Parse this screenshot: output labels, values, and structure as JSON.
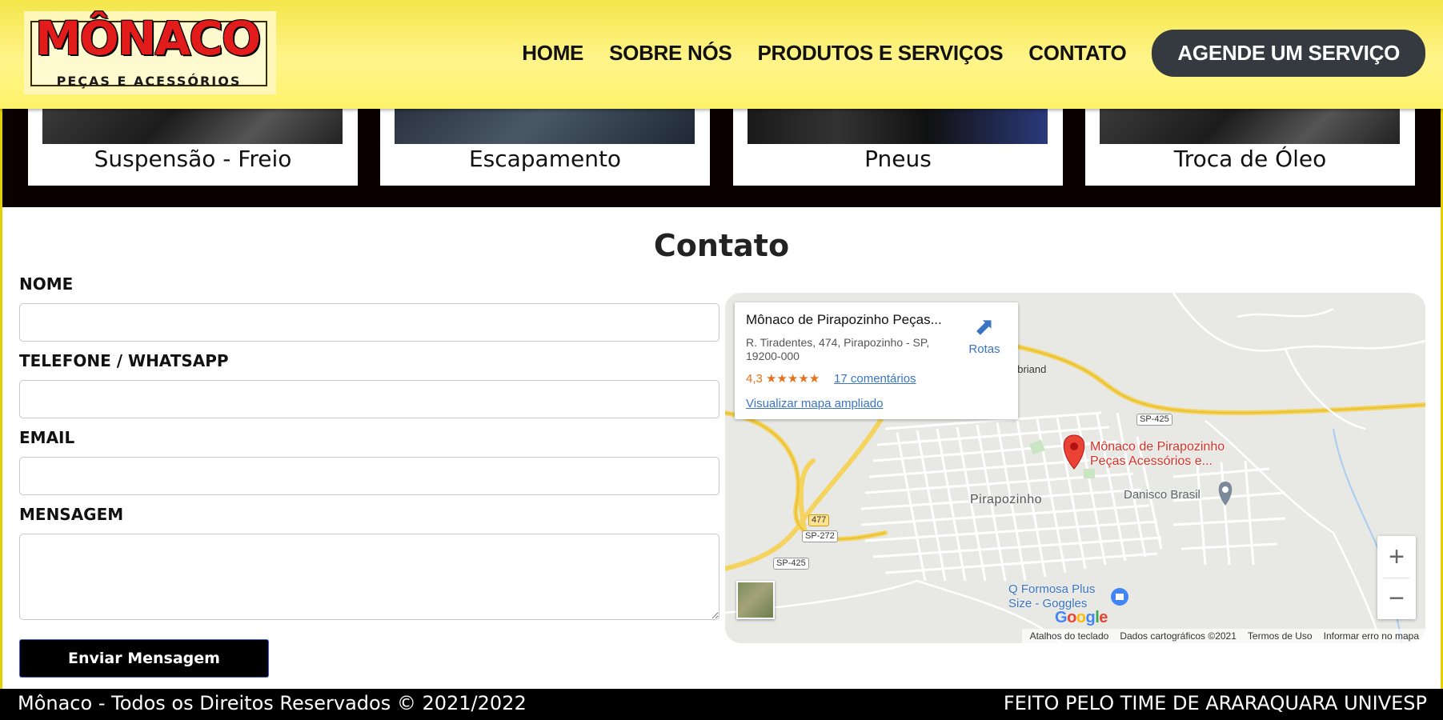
{
  "brand": {
    "logo_word": "MÔNACO",
    "logo_sub": "PEÇAS E ACESSÓRIOS",
    "colors": {
      "header_yellow": "#fff48a",
      "logo_red": "#e21b1b",
      "cta_bg": "#343a40"
    }
  },
  "nav": {
    "home": "HOME",
    "about": "SOBRE NÓS",
    "products": "PRODUTOS E SERVIÇOS",
    "contact": "CONTATO",
    "cta": "AGENDE UM SERVIÇO"
  },
  "services": [
    {
      "label": "Suspensão - Freio"
    },
    {
      "label": "Escapamento"
    },
    {
      "label": "Pneus"
    },
    {
      "label": "Troca de Óleo"
    }
  ],
  "contact": {
    "title": "Contato",
    "fields": {
      "name_label": "NOME",
      "phone_label": "TELEFONE / WHATSAPP",
      "email_label": "EMAIL",
      "message_label": "MENSAGEM"
    },
    "submit": "Enviar Mensagem"
  },
  "map": {
    "place_name": "Mônaco de Pirapozinho Peças...",
    "address": "R. Tiradentes, 474, Pirapozinho - SP, 19200-000",
    "rating": "4,3",
    "stars": "★★★★★",
    "reviews": "17 comentários",
    "view_larger": "Visualizar mapa ampliado",
    "directions": "Rotas",
    "pin_label_1": "Mônaco de Pirapozinho",
    "pin_label_2": "Peças Acessórios e...",
    "town": "Pirapozinho",
    "poi_danisco": "Danisco Brasil",
    "poi_formosa_1": "Q Formosa Plus",
    "poi_formosa_2": "Size - Goggles",
    "place_tubriand": "ubriand",
    "road_sp425_a": "SP-425",
    "road_sp425_b": "SP-425",
    "road_sp272": "SP-272",
    "road_477": "477",
    "zoom_in": "+",
    "zoom_out": "−",
    "attrib": {
      "shortcuts": "Atalhos do teclado",
      "data": "Dados cartográficos ©2021",
      "terms": "Termos de Uso",
      "report": "Informar erro no mapa"
    },
    "google_logo": "Google"
  },
  "footer": {
    "left": "Mônaco - Todos os Direitos Reservados © 2021/2022",
    "right": "FEITO PELO TIME DE ARARAQUARA UNIVESP"
  }
}
